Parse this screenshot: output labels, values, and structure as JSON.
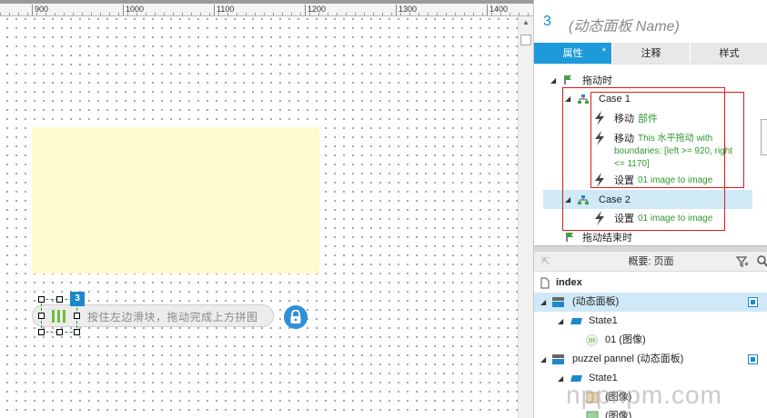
{
  "ruler": {
    "ticks": [
      "900",
      "1000",
      "1100",
      "1200",
      "1300",
      "1400"
    ]
  },
  "canvas": {
    "slider_hint": "按住左边滑块，拖动完成上方拼图",
    "badge": "3",
    "lock_icon": "lock-icon",
    "colors": {
      "placeholder_yellow": "#fffbcf",
      "accent_blue": "#1d89c9",
      "selection_green": "#2a8f2a"
    }
  },
  "panel": {
    "title_number": "3",
    "title_name": "(动态面板 Name)",
    "tabs": [
      {
        "label": "属性",
        "modified_marker": "*",
        "active": true
      },
      {
        "label": "注释",
        "active": false
      },
      {
        "label": "样式",
        "active": false
      }
    ],
    "events": {
      "drag_event": "拖动时",
      "case1": {
        "name": "Case 1",
        "actions": [
          {
            "verb": "移动",
            "target": "部件"
          },
          {
            "verb": "移动",
            "target": "This 水平拖动 with",
            "line2": "boundaries: [left >= 920, right",
            "line3": "<= 1170]"
          },
          {
            "verb": "设置",
            "target": "01 image to image"
          }
        ]
      },
      "case2": {
        "name": "Case 2",
        "actions": [
          {
            "verb": "设置",
            "target": "01 image to image"
          }
        ]
      },
      "drag_end_event": "拖动结束时"
    }
  },
  "outline": {
    "header": "概要: 页面",
    "items": [
      {
        "label": "index",
        "level": 0,
        "type": "page"
      },
      {
        "label": "(动态面板)",
        "level": 0,
        "type": "dynamic-panel",
        "selected": true
      },
      {
        "label": "State1",
        "level": 1,
        "type": "state"
      },
      {
        "label": "01 (图像)",
        "level": 2,
        "type": "image"
      },
      {
        "label": "puzzel pannel (动态面板)",
        "level": 0,
        "type": "dynamic-panel"
      },
      {
        "label": "State1",
        "level": 1,
        "type": "state"
      },
      {
        "label": "(图像)",
        "level": 2,
        "type": "image"
      },
      {
        "label": "(图像)",
        "level": 2,
        "type": "image"
      }
    ]
  },
  "watermark": "nppnpm.com"
}
